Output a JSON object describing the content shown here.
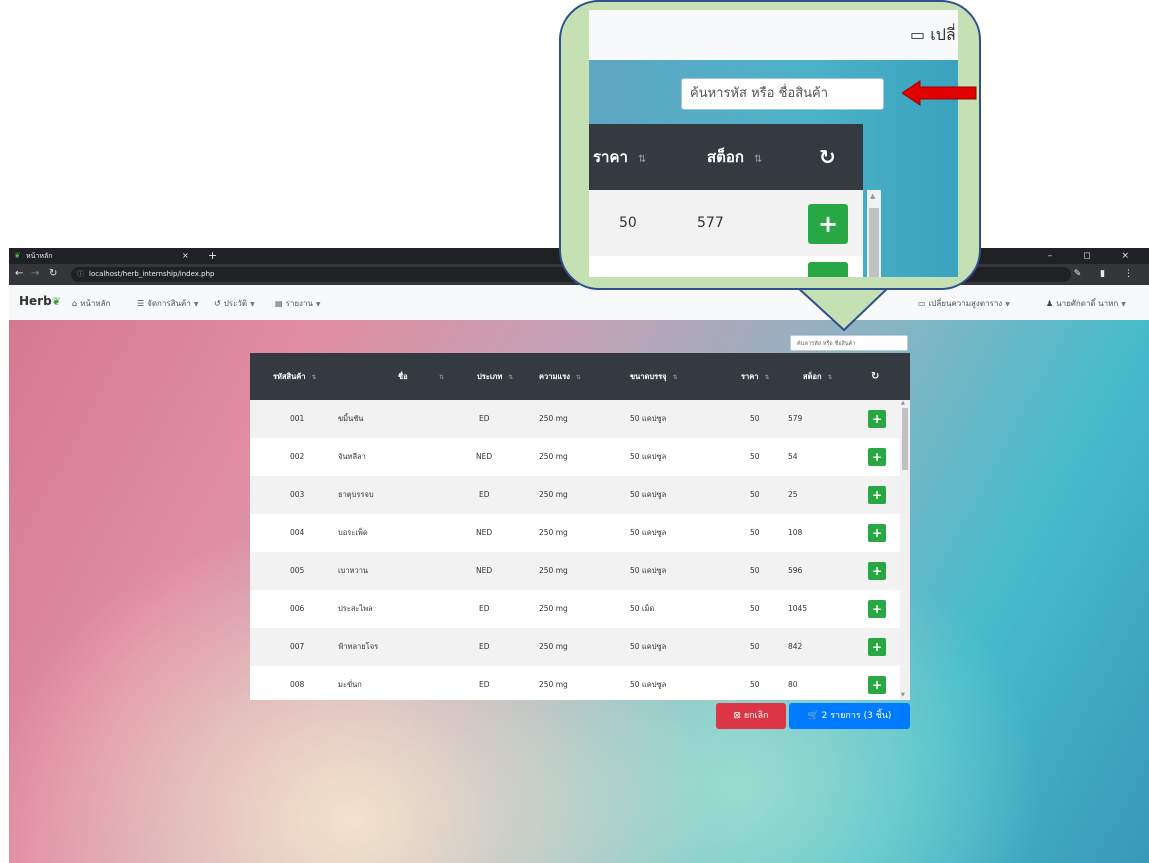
{
  "browser": {
    "tab_title": "หน้าหลัก",
    "tab_close": "×",
    "new_tab": "+",
    "window_controls": "– ◻ ×",
    "url_info": "ⓘ",
    "url": "localhost/herb_internship/index.php"
  },
  "nav": {
    "brand": "Herb",
    "items": [
      {
        "icon": "home-icon",
        "label": "หน้าหลัก"
      },
      {
        "icon": "list-icon",
        "label": "จัดการสินค้า"
      },
      {
        "icon": "history-icon",
        "label": "ประวัติ"
      },
      {
        "icon": "report-icon",
        "label": "รายงาน"
      }
    ],
    "row_height_toggle": "เปลี่ยนความสูงตาราง",
    "user": "นายศักดาดิ์ นาหก"
  },
  "search": {
    "placeholder": "ค้นหารหัส หรือ ชื่อสินค้า"
  },
  "table": {
    "headers": [
      "รหัสสินค้า",
      "ชื่อ",
      "ประเภท",
      "ความแรง",
      "ขนาดบรรจุ",
      "ราคา",
      "สต็อก"
    ],
    "rows": [
      [
        "001",
        "ขมิ้นชัน",
        "ED",
        "250 mg",
        "50 แคปซูล",
        "50",
        "579"
      ],
      [
        "002",
        "จันทลีลา",
        "NED",
        "250 mg",
        "50 แคปซูล",
        "50",
        "54"
      ],
      [
        "003",
        "ธาตุบรรจบ",
        "ED",
        "250 mg",
        "50 แคปซูล",
        "50",
        "25"
      ],
      [
        "004",
        "บอระเพ็ด",
        "NED",
        "250 mg",
        "50 แคปซูล",
        "50",
        "108"
      ],
      [
        "005",
        "เบาหวาน",
        "NED",
        "250 mg",
        "50 แคปซูล",
        "50",
        "596"
      ],
      [
        "006",
        "ประสะไพล",
        "ED",
        "250 mg",
        "50 เม็ด",
        "50",
        "1045"
      ],
      [
        "007",
        "ฟ้าทลายโจร",
        "ED",
        "250 mg",
        "50 แคปซูล",
        "50",
        "842"
      ],
      [
        "008",
        "มะขั่นก",
        "ED",
        "250 mg",
        "50 แคปซูล",
        "50",
        "80"
      ]
    ]
  },
  "actions": {
    "cancel": "ยกเลิก",
    "cart": "2 รายการ (3 ชิ้น)"
  },
  "zoom": {
    "nav_label": "เปลี่",
    "search_placeholder": "ค้นหารหัส หรือ ชื่อสินค้า",
    "header_price": "ราคา",
    "header_stock": "สต็อก",
    "row_price": "50",
    "row_stock": "577"
  },
  "colors": {
    "add": "#28a745",
    "cancel": "#dc3545",
    "cart": "#007bff",
    "header": "#343a40",
    "callout": "#c5e0b3",
    "arrow": "#e00000"
  }
}
